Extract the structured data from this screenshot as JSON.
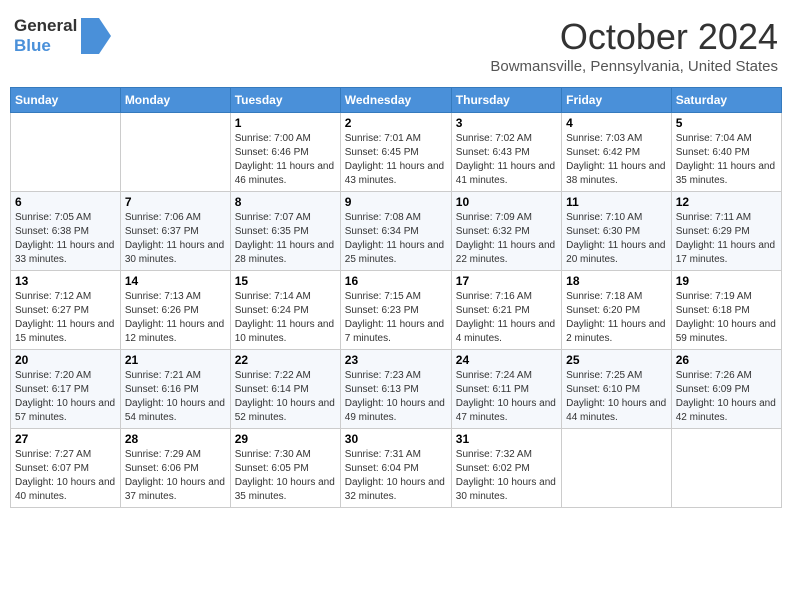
{
  "header": {
    "logo_general": "General",
    "logo_blue": "Blue",
    "month": "October 2024",
    "location": "Bowmansville, Pennsylvania, United States"
  },
  "weekdays": [
    "Sunday",
    "Monday",
    "Tuesday",
    "Wednesday",
    "Thursday",
    "Friday",
    "Saturday"
  ],
  "weeks": [
    [
      {
        "day": "",
        "sunrise": "",
        "sunset": "",
        "daylight": ""
      },
      {
        "day": "",
        "sunrise": "",
        "sunset": "",
        "daylight": ""
      },
      {
        "day": "1",
        "sunrise": "Sunrise: 7:00 AM",
        "sunset": "Sunset: 6:46 PM",
        "daylight": "Daylight: 11 hours and 46 minutes."
      },
      {
        "day": "2",
        "sunrise": "Sunrise: 7:01 AM",
        "sunset": "Sunset: 6:45 PM",
        "daylight": "Daylight: 11 hours and 43 minutes."
      },
      {
        "day": "3",
        "sunrise": "Sunrise: 7:02 AM",
        "sunset": "Sunset: 6:43 PM",
        "daylight": "Daylight: 11 hours and 41 minutes."
      },
      {
        "day": "4",
        "sunrise": "Sunrise: 7:03 AM",
        "sunset": "Sunset: 6:42 PM",
        "daylight": "Daylight: 11 hours and 38 minutes."
      },
      {
        "day": "5",
        "sunrise": "Sunrise: 7:04 AM",
        "sunset": "Sunset: 6:40 PM",
        "daylight": "Daylight: 11 hours and 35 minutes."
      }
    ],
    [
      {
        "day": "6",
        "sunrise": "Sunrise: 7:05 AM",
        "sunset": "Sunset: 6:38 PM",
        "daylight": "Daylight: 11 hours and 33 minutes."
      },
      {
        "day": "7",
        "sunrise": "Sunrise: 7:06 AM",
        "sunset": "Sunset: 6:37 PM",
        "daylight": "Daylight: 11 hours and 30 minutes."
      },
      {
        "day": "8",
        "sunrise": "Sunrise: 7:07 AM",
        "sunset": "Sunset: 6:35 PM",
        "daylight": "Daylight: 11 hours and 28 minutes."
      },
      {
        "day": "9",
        "sunrise": "Sunrise: 7:08 AM",
        "sunset": "Sunset: 6:34 PM",
        "daylight": "Daylight: 11 hours and 25 minutes."
      },
      {
        "day": "10",
        "sunrise": "Sunrise: 7:09 AM",
        "sunset": "Sunset: 6:32 PM",
        "daylight": "Daylight: 11 hours and 22 minutes."
      },
      {
        "day": "11",
        "sunrise": "Sunrise: 7:10 AM",
        "sunset": "Sunset: 6:30 PM",
        "daylight": "Daylight: 11 hours and 20 minutes."
      },
      {
        "day": "12",
        "sunrise": "Sunrise: 7:11 AM",
        "sunset": "Sunset: 6:29 PM",
        "daylight": "Daylight: 11 hours and 17 minutes."
      }
    ],
    [
      {
        "day": "13",
        "sunrise": "Sunrise: 7:12 AM",
        "sunset": "Sunset: 6:27 PM",
        "daylight": "Daylight: 11 hours and 15 minutes."
      },
      {
        "day": "14",
        "sunrise": "Sunrise: 7:13 AM",
        "sunset": "Sunset: 6:26 PM",
        "daylight": "Daylight: 11 hours and 12 minutes."
      },
      {
        "day": "15",
        "sunrise": "Sunrise: 7:14 AM",
        "sunset": "Sunset: 6:24 PM",
        "daylight": "Daylight: 11 hours and 10 minutes."
      },
      {
        "day": "16",
        "sunrise": "Sunrise: 7:15 AM",
        "sunset": "Sunset: 6:23 PM",
        "daylight": "Daylight: 11 hours and 7 minutes."
      },
      {
        "day": "17",
        "sunrise": "Sunrise: 7:16 AM",
        "sunset": "Sunset: 6:21 PM",
        "daylight": "Daylight: 11 hours and 4 minutes."
      },
      {
        "day": "18",
        "sunrise": "Sunrise: 7:18 AM",
        "sunset": "Sunset: 6:20 PM",
        "daylight": "Daylight: 11 hours and 2 minutes."
      },
      {
        "day": "19",
        "sunrise": "Sunrise: 7:19 AM",
        "sunset": "Sunset: 6:18 PM",
        "daylight": "Daylight: 10 hours and 59 minutes."
      }
    ],
    [
      {
        "day": "20",
        "sunrise": "Sunrise: 7:20 AM",
        "sunset": "Sunset: 6:17 PM",
        "daylight": "Daylight: 10 hours and 57 minutes."
      },
      {
        "day": "21",
        "sunrise": "Sunrise: 7:21 AM",
        "sunset": "Sunset: 6:16 PM",
        "daylight": "Daylight: 10 hours and 54 minutes."
      },
      {
        "day": "22",
        "sunrise": "Sunrise: 7:22 AM",
        "sunset": "Sunset: 6:14 PM",
        "daylight": "Daylight: 10 hours and 52 minutes."
      },
      {
        "day": "23",
        "sunrise": "Sunrise: 7:23 AM",
        "sunset": "Sunset: 6:13 PM",
        "daylight": "Daylight: 10 hours and 49 minutes."
      },
      {
        "day": "24",
        "sunrise": "Sunrise: 7:24 AM",
        "sunset": "Sunset: 6:11 PM",
        "daylight": "Daylight: 10 hours and 47 minutes."
      },
      {
        "day": "25",
        "sunrise": "Sunrise: 7:25 AM",
        "sunset": "Sunset: 6:10 PM",
        "daylight": "Daylight: 10 hours and 44 minutes."
      },
      {
        "day": "26",
        "sunrise": "Sunrise: 7:26 AM",
        "sunset": "Sunset: 6:09 PM",
        "daylight": "Daylight: 10 hours and 42 minutes."
      }
    ],
    [
      {
        "day": "27",
        "sunrise": "Sunrise: 7:27 AM",
        "sunset": "Sunset: 6:07 PM",
        "daylight": "Daylight: 10 hours and 40 minutes."
      },
      {
        "day": "28",
        "sunrise": "Sunrise: 7:29 AM",
        "sunset": "Sunset: 6:06 PM",
        "daylight": "Daylight: 10 hours and 37 minutes."
      },
      {
        "day": "29",
        "sunrise": "Sunrise: 7:30 AM",
        "sunset": "Sunset: 6:05 PM",
        "daylight": "Daylight: 10 hours and 35 minutes."
      },
      {
        "day": "30",
        "sunrise": "Sunrise: 7:31 AM",
        "sunset": "Sunset: 6:04 PM",
        "daylight": "Daylight: 10 hours and 32 minutes."
      },
      {
        "day": "31",
        "sunrise": "Sunrise: 7:32 AM",
        "sunset": "Sunset: 6:02 PM",
        "daylight": "Daylight: 10 hours and 30 minutes."
      },
      {
        "day": "",
        "sunrise": "",
        "sunset": "",
        "daylight": ""
      },
      {
        "day": "",
        "sunrise": "",
        "sunset": "",
        "daylight": ""
      }
    ]
  ]
}
